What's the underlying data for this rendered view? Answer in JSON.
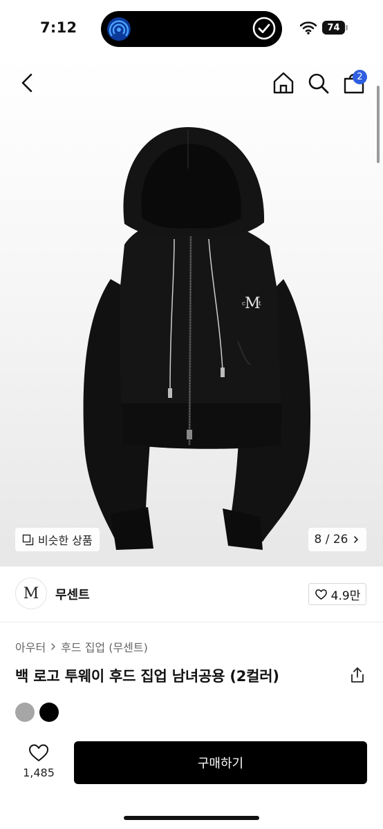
{
  "status_bar": {
    "time": "7:12",
    "battery": "74",
    "icons": [
      "broadcast-icon",
      "checkmark-circle-icon",
      "wifi-icon",
      "battery-icon"
    ]
  },
  "nav": {
    "icons": [
      "back-chevron-icon",
      "home-icon",
      "search-icon",
      "cart-icon"
    ],
    "cart_badge": "2"
  },
  "gallery": {
    "image": "black cropped zip-up hoodie with embroidered M logo",
    "similar_label": "비슷한 상품",
    "page_indicator": "8 / 26",
    "icons": [
      "similar-items-icon",
      "chevron-right-icon"
    ]
  },
  "brand": {
    "logo_text": "M",
    "name": "무센트",
    "likes": "4.9만"
  },
  "product": {
    "breadcrumb": [
      "아우터",
      "후드 집업 (무센트)"
    ],
    "title": "백 로고 투웨이 후드 집업 남녀공용 (2컬러)",
    "swatches": [
      {
        "name": "gray",
        "color": "#a6a6a6"
      },
      {
        "name": "black",
        "color": "#000000"
      }
    ]
  },
  "bottom_bar": {
    "wishlist_count": "1,485",
    "buy_label": "구매하기"
  },
  "colors": {
    "accent": "#2f5fe0",
    "buy_button": "#000000"
  }
}
